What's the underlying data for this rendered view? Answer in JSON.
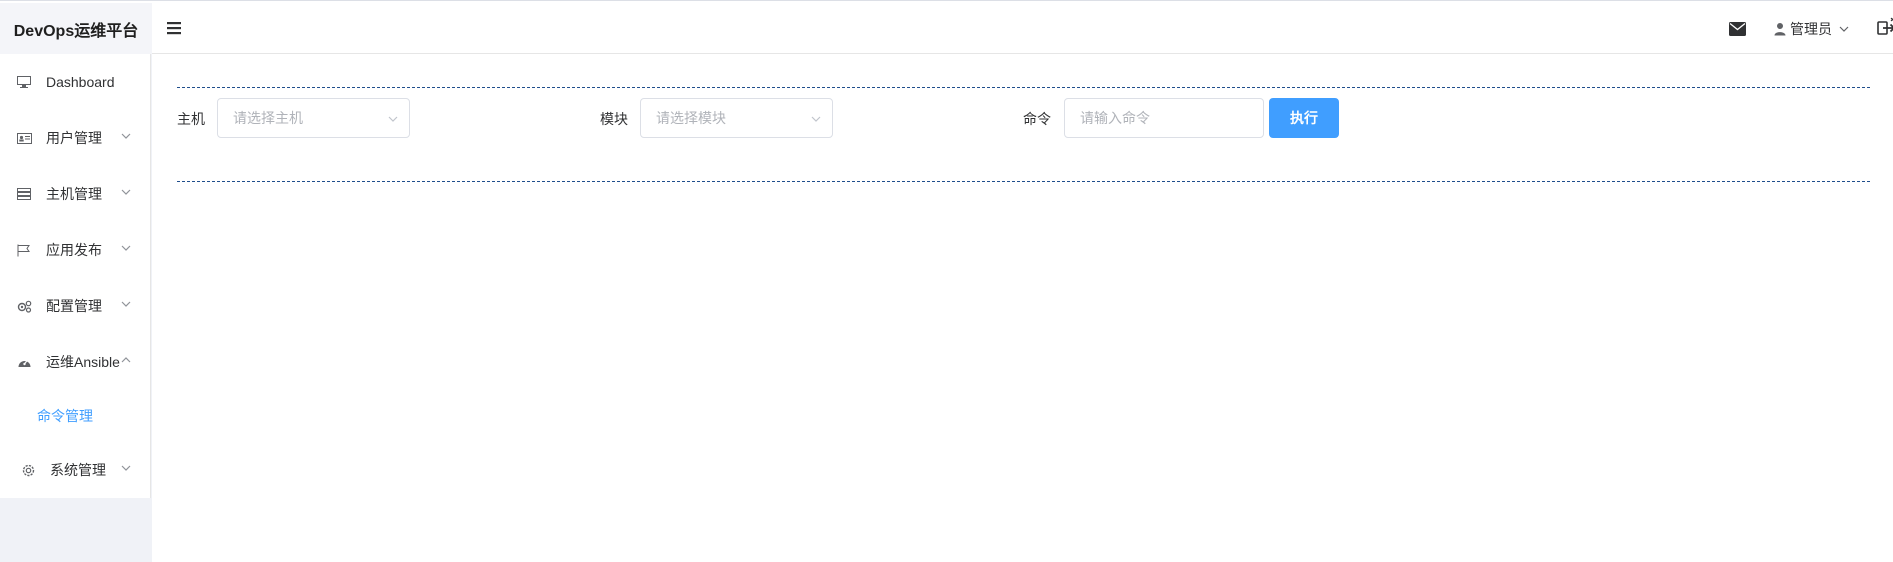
{
  "app": {
    "title": "DevOps运维平台"
  },
  "sidebar": {
    "items": [
      {
        "label": "Dashboard",
        "icon": "monitor-icon"
      },
      {
        "label": "用户管理",
        "icon": "id-card-icon"
      },
      {
        "label": "主机管理",
        "icon": "server-icon"
      },
      {
        "label": "应用发布",
        "icon": "flag-icon"
      },
      {
        "label": "配置管理",
        "icon": "gears-icon"
      },
      {
        "label": "运维Ansible",
        "icon": "dashboard-gauge-icon"
      },
      {
        "label": "系统管理",
        "icon": "gear-icon"
      }
    ],
    "active_sub": {
      "label": "命令管理"
    }
  },
  "header": {
    "user_label": "管理员"
  },
  "form": {
    "host_label": "主机",
    "host_placeholder": "请选择主机",
    "module_label": "模块",
    "module_placeholder": "请选择模块",
    "command_label": "命令",
    "command_placeholder": "请输入命令",
    "execute_label": "执行"
  },
  "colors": {
    "accent": "#409eff",
    "dash_line": "#1f4e8c",
    "sidebar_bg": "#f0f2f7"
  }
}
